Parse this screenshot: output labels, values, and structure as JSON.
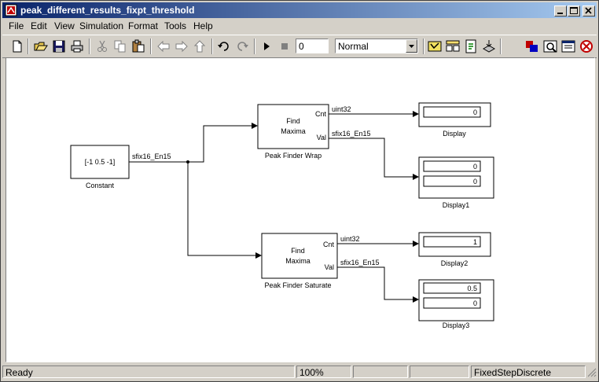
{
  "window": {
    "title": "peak_different_results_fixpt_threshold",
    "controls": [
      "minimize",
      "maximize",
      "close"
    ]
  },
  "menu": {
    "items": [
      {
        "label": "File"
      },
      {
        "label": "Edit"
      },
      {
        "label": "View"
      },
      {
        "label": "Simulation"
      },
      {
        "label": "Format"
      },
      {
        "label": "Tools"
      },
      {
        "label": "Help"
      }
    ]
  },
  "toolbar": {
    "stop_time": "0",
    "sim_mode": "Normal",
    "icons": [
      "new-icon",
      "open-icon",
      "save-icon",
      "print-icon",
      "cut-icon",
      "copy-icon",
      "paste-icon",
      "back-icon",
      "forward-icon",
      "up-icon",
      "undo-icon",
      "redo-icon",
      "start-icon",
      "stop-icon",
      "model-advisor-icon",
      "library-icon",
      "build-icon",
      "update-icon",
      "debug-icon",
      "explorer-icon",
      "browser-icon",
      "diagnostics-icon"
    ]
  },
  "diagram": {
    "constant": {
      "value": "[-1 0.5 -1]",
      "name": "Constant",
      "out_type": "sfix16_En15"
    },
    "finder1": {
      "line1": "Find",
      "line2": "Maxima",
      "port_cnt": "Cnt",
      "port_val": "Val",
      "name": "Peak Finder Wrap",
      "cnt_type": "uint32",
      "val_type": "sfix16_En15"
    },
    "finder2": {
      "line1": "Find",
      "line2": "Maxima",
      "port_cnt": "Cnt",
      "port_val": "Val",
      "name": "Peak Finder Saturate",
      "cnt_type": "uint32",
      "val_type": "sfix16_En15"
    },
    "display": {
      "name": "Display",
      "values": [
        "0"
      ]
    },
    "display1": {
      "name": "Display1",
      "values": [
        "0",
        "0"
      ]
    },
    "display2": {
      "name": "Display2",
      "values": [
        "1"
      ]
    },
    "display3": {
      "name": "Display3",
      "values": [
        "0.5",
        "0"
      ]
    }
  },
  "status": {
    "state": "Ready",
    "zoom": "100%",
    "panel3": "",
    "panel4": "",
    "solver": "FixedStepDiscrete"
  }
}
